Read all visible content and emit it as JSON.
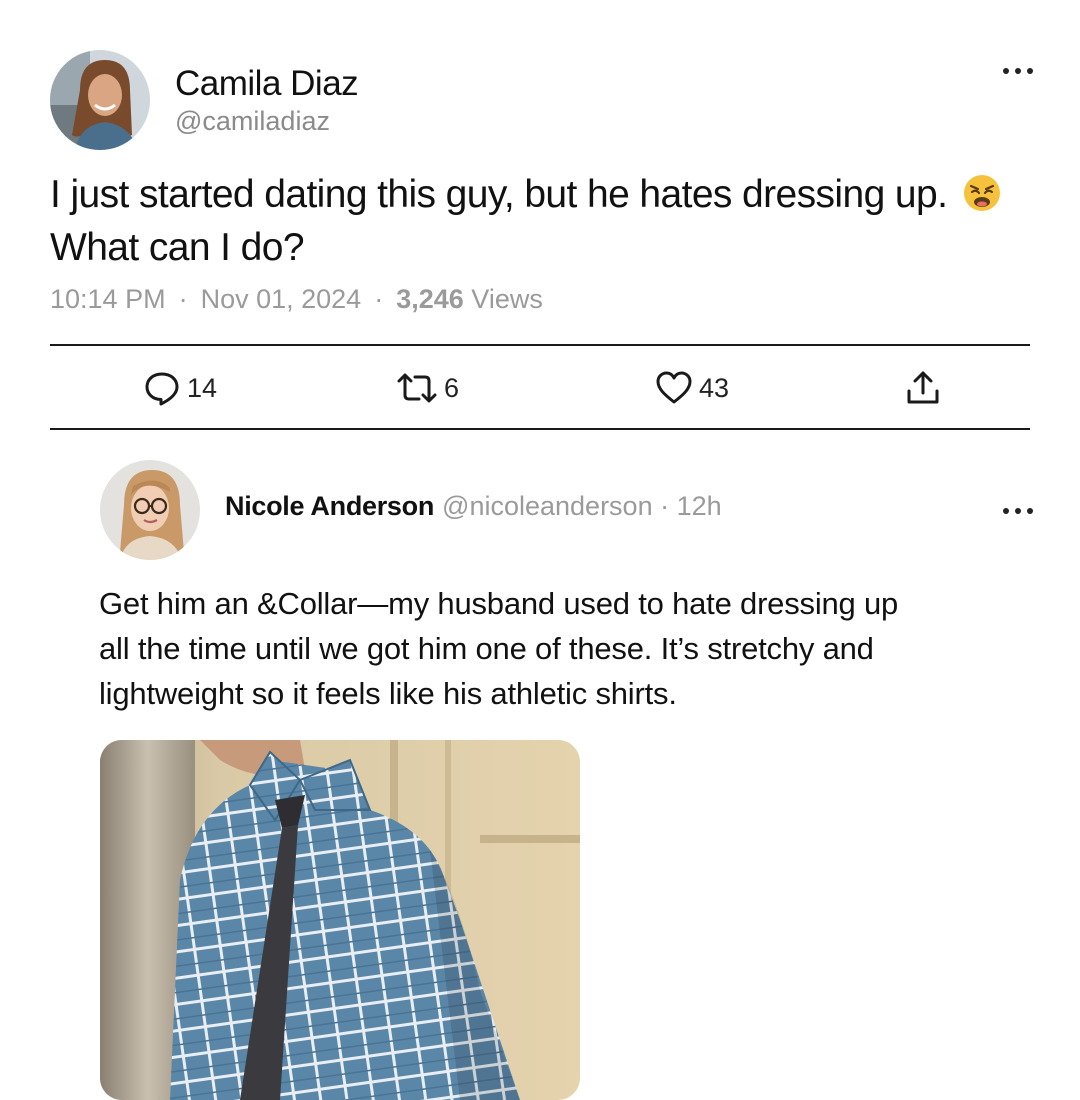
{
  "tweet": {
    "author_name": "Camila Diaz",
    "author_handle": "@camiladiaz",
    "text_line1": "I just started dating this guy, but he hates dressing up.",
    "text_line2": "What can I do?",
    "emoji": "weary-face",
    "time": "10:14 PM",
    "separator": "·",
    "date": "Nov 01, 2024",
    "views_count": "3,246",
    "views_label": "Views",
    "actions": {
      "replies": "14",
      "retweets": "6",
      "likes": "43"
    }
  },
  "reply": {
    "author_name": "Nicole Anderson",
    "author_handle": "@nicoleanderson",
    "time": "· 12h",
    "text_line1": "Get him an &Collar—my husband used to hate dressing up",
    "text_line2": "all the time until we got him one of these. It’s stretchy and",
    "text_line3": "lightweight so it feels like his athletic shirts."
  },
  "icons": {
    "reply": "speech-bubble-icon",
    "retweet": "retweet-icon",
    "like": "heart-icon",
    "share": "share-upload-icon",
    "more": "more-dots-icon"
  },
  "colors": {
    "text": "#111111",
    "secondary": "#9a9a9a",
    "rule": "#1a1a1a",
    "shirt_blue": "#5a86a8"
  }
}
